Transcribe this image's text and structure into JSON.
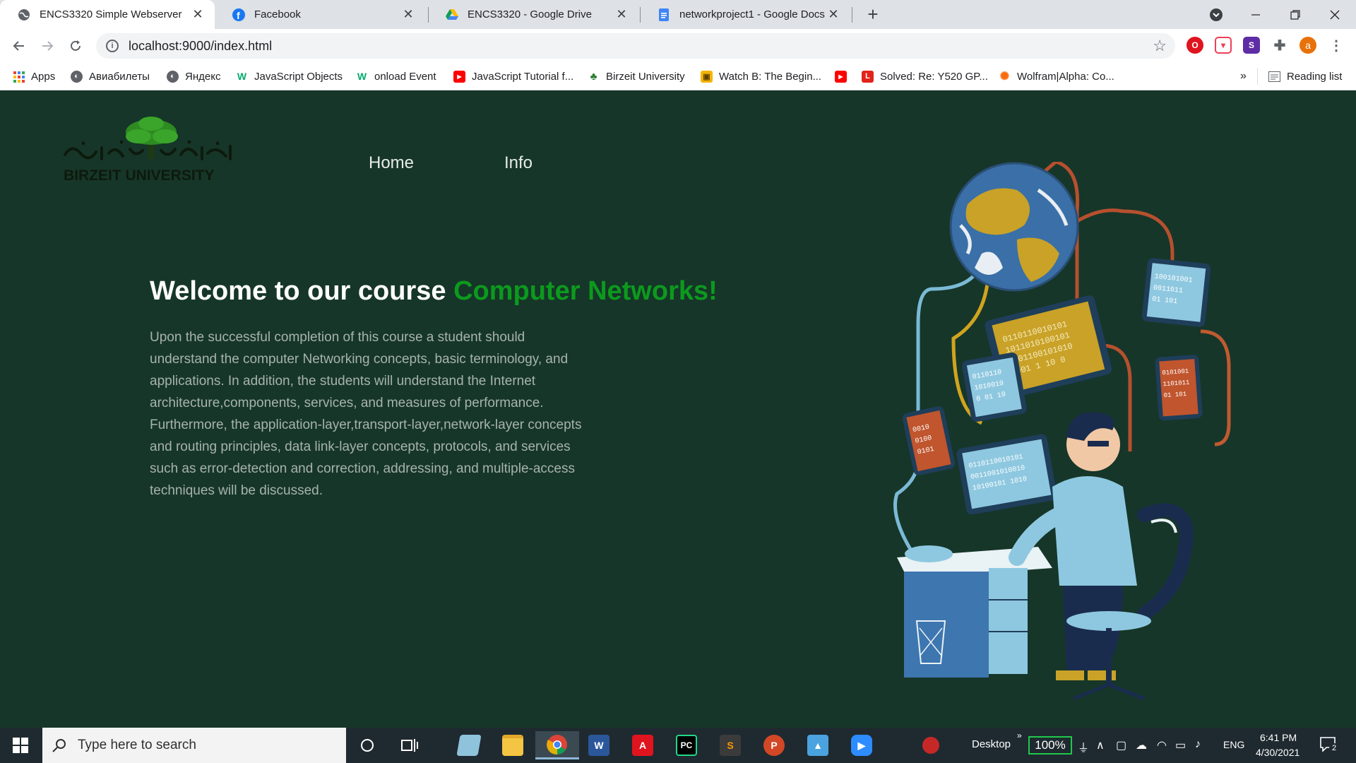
{
  "browser": {
    "tabs": [
      {
        "title": "ENCS3320 Simple Webserver",
        "icon": "globe-icon",
        "active": true
      },
      {
        "title": "Facebook",
        "icon": "facebook-icon",
        "active": false
      },
      {
        "title": "ENCS3320 - Google Drive",
        "icon": "google-drive-icon",
        "active": false
      },
      {
        "title": "networkproject1 - Google Docs",
        "icon": "google-docs-icon",
        "active": false
      }
    ],
    "url": "localhost:9000/index.html",
    "profile_initial": "a",
    "bookmarks": [
      {
        "label": "Apps",
        "icon": "apps-grid-icon"
      },
      {
        "label": "Авиабилеты",
        "icon": "globe-icon"
      },
      {
        "label": "Яндекс",
        "icon": "globe-icon"
      },
      {
        "label": "JavaScript Objects",
        "icon": "w3schools-icon"
      },
      {
        "label": "onload Event",
        "icon": "w3schools-icon"
      },
      {
        "label": "JavaScript Tutorial f...",
        "icon": "youtube-icon"
      },
      {
        "label": "Birzeit University",
        "icon": "tree-icon"
      },
      {
        "label": "Watch B: The Begin...",
        "icon": "bookmark-site-icon"
      },
      {
        "label": "",
        "icon": "youtube-icon"
      },
      {
        "label": "Solved: Re: Y520 GP...",
        "icon": "lenovo-icon"
      },
      {
        "label": "Wolfram|Alpha: Co...",
        "icon": "wolfram-icon"
      }
    ],
    "reading_list": "Reading list",
    "overflow": "»"
  },
  "site": {
    "logo_text": "BIRZEIT UNIVERSITY",
    "logo_arabic": "جامعة بيرزيت",
    "nav": [
      {
        "label": "Home"
      },
      {
        "label": "Info"
      }
    ],
    "headline_prefix": "Welcome to our course ",
    "headline_accent": "Computer Networks!",
    "description": "Upon the successful completion of this course a student should understand the computer Networking concepts, basic terminology, and applications. In addition, the students will understand the Internet architecture,components, services, and measures of performance. Furthermore, the application-layer,transport-layer,network-layer concepts and routing principles, data link-layer concepts, protocols, and services such as error-detection and correction, addressing, and multiple-access techniques will be discussed."
  },
  "taskbar": {
    "search_placeholder": "Type here to search",
    "desktop_label": "Desktop",
    "battery": "100%",
    "language": "ENG",
    "time": "6:41 PM",
    "date": "4/30/2021",
    "notification_count": "2",
    "apps": [
      "chrome-icon",
      "word-icon",
      "acrobat-icon",
      "pycharm-icon",
      "sublime-icon",
      "powerpoint-icon",
      "photos-icon",
      "zoom-icon"
    ]
  },
  "colors": {
    "page_bg": "#163629",
    "accent_green": "#0c9a1d",
    "body_text": "#a7b3ad"
  }
}
